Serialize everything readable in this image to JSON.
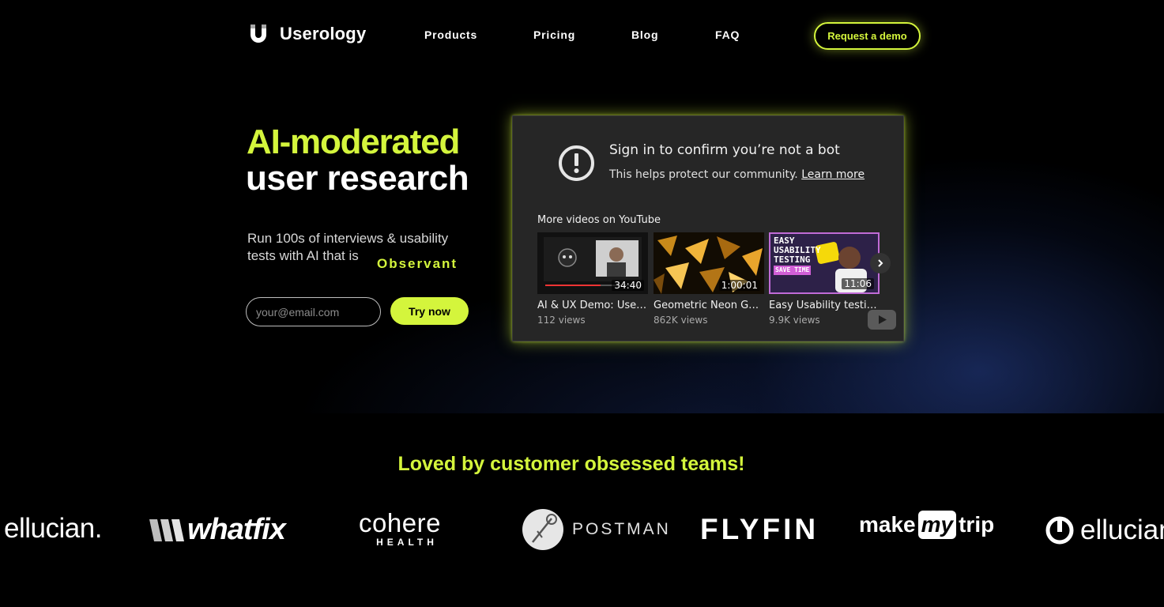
{
  "brand": {
    "name": "Userology",
    "logo_icon": "magnet-u-icon"
  },
  "nav": {
    "links": [
      "Products",
      "Pricing",
      "Blog",
      "FAQ"
    ],
    "cta": "Request a demo"
  },
  "hero": {
    "headline_accent": "AI-moderated",
    "headline_main": "user research",
    "subtitle_line1": "Run 100s of interviews & usability",
    "subtitle_line2": "tests with AI that is",
    "subtitle_keyword": "Observant",
    "email_placeholder": "your@email.com",
    "try_button": "Try now"
  },
  "embed": {
    "title": "Sign in to confirm you’re not a bot",
    "subtitle": "This helps protect our community.",
    "learn_more": "Learn more",
    "more_videos": "More videos on YouTube",
    "videos": [
      {
        "title": "AI & UX Demo: User Research Automation",
        "views": "112 views",
        "duration": "34:40"
      },
      {
        "title": "Geometric Neon Gold Abstract",
        "views": "862K views",
        "duration": "1:00:01"
      },
      {
        "title": "Easy Usability testing",
        "views": "9.9K views",
        "duration": "11:06",
        "thumb_text": [
          "EASY",
          "USABILITY",
          "TESTING"
        ],
        "thumb_badge": "SAVE TIME"
      }
    ]
  },
  "trusted": {
    "heading": "Loved by customer obsessed teams!",
    "logos": [
      "ellucian.",
      "whatfix",
      "cohere",
      "HEALTH",
      "POSTMAN",
      "FLYFIN",
      "make",
      "my",
      "trip",
      "ellucian"
    ]
  },
  "colors": {
    "accent": "#d4f53c",
    "background": "#000000",
    "embed_bg": "#262626"
  }
}
